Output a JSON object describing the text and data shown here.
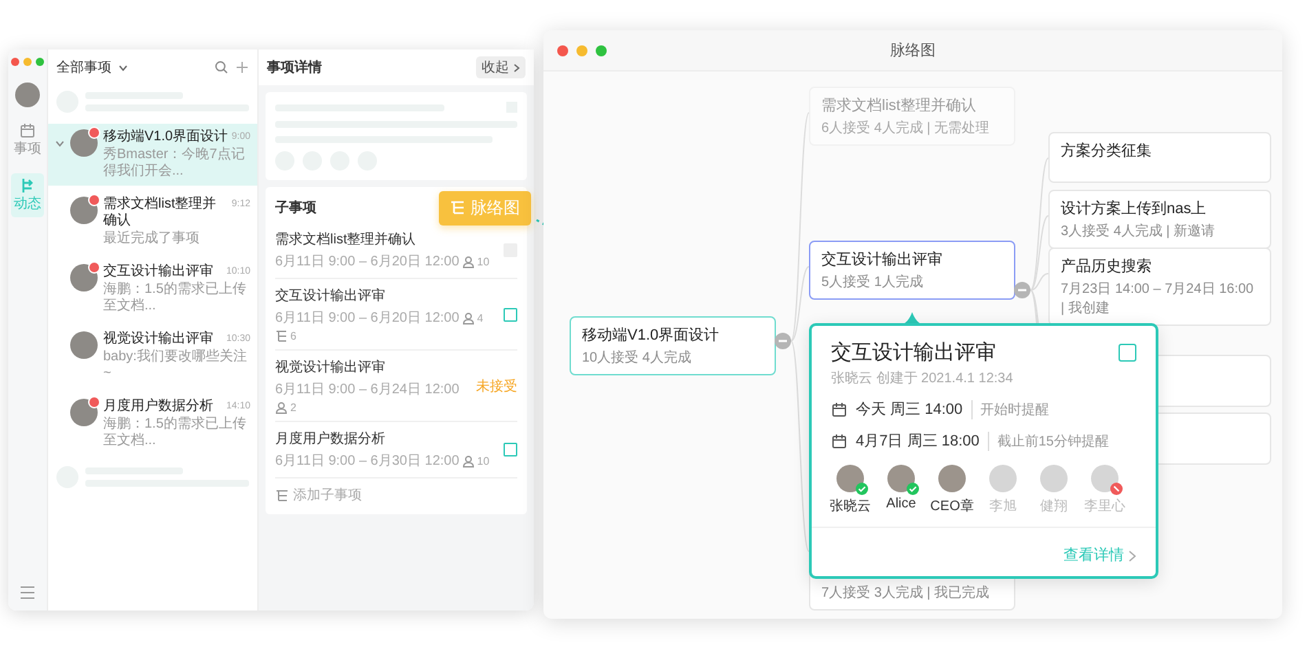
{
  "left_window": {
    "sidebar": [
      {
        "label": "事项",
        "selected": false
      },
      {
        "label": "动态",
        "selected": true
      }
    ],
    "list": {
      "filter": "全部事项",
      "items": [
        {
          "title": "移动端V1.0界面设计",
          "time": "9:00",
          "preview": "秀Bmaster：今晚7点记得我们开会...",
          "selected": true,
          "unread": true,
          "expanded": true,
          "children": [
            {
              "title": "需求文档list整理并确认",
              "time": "9:12",
              "preview": "最近完成了事项",
              "selected": false,
              "unread": true
            },
            {
              "title": "交互设计输出评审",
              "time": "10:10",
              "preview": "海鹏：1.5的需求已上传至文档...",
              "selected": false,
              "unread": true
            },
            {
              "title": "视觉设计输出评审",
              "time": "10:30",
              "preview": "baby:我们要改哪些关注~",
              "selected": false,
              "unread": false
            },
            {
              "title": "月度用户数据分析",
              "time": "14:10",
              "preview": "海鹏：1.5的需求已上传至文档...",
              "selected": false,
              "unread": true
            }
          ]
        }
      ]
    },
    "detail": {
      "title": "事项详情",
      "collapse_button": "收起",
      "section_title": "子事项",
      "subtasks": [
        {
          "title": "需求文档list整理并确认",
          "dates": "6月11日 9:00 – 6月20日 12:00",
          "assignees": "10",
          "kind": "checkbox",
          "disabled": true
        },
        {
          "title": "交互设计输出评审",
          "dates": "6月11日 9:00 – 6月20日 12:00",
          "assignees": "4",
          "subtasks": "6",
          "kind": "checkbox",
          "disabled": false
        },
        {
          "title": "视觉设计输出评审",
          "dates": "6月11日 9:00 – 6月24日 12:00",
          "assignees": "2",
          "kind": "status",
          "status": "未接受"
        },
        {
          "title": "月度用户数据分析",
          "dates": "6月11日 9:00 – 6月30日 12:00",
          "assignees": "10",
          "kind": "checkbox",
          "disabled": false
        }
      ],
      "add_button": "添加子事项"
    }
  },
  "mind_map_button": "脉络图",
  "right_window": {
    "title": "脉络图",
    "root": {
      "title": "移动端V1.0界面设计",
      "meta": "10人接受 4人完成"
    },
    "branches": [
      {
        "title": "需求文档list整理并确认",
        "meta": "6人接受 4人完成 | 无需处理",
        "faded": true,
        "selected": false
      },
      {
        "title": "交互设计输出评审",
        "meta": "5人接受 1人完成",
        "faded": false,
        "selected": true
      },
      {
        "meta": "7人接受 3人完成 | 我已完成",
        "faded": false,
        "selected": false
      }
    ],
    "leaves": [
      {
        "title": "方案分类征集"
      },
      {
        "title": "设计方案上传到nas上",
        "meta": "3人接受 4人完成 | 新邀请"
      },
      {
        "title": "产品历史搜索",
        "meta": "7月23日 14:00 – 7月24日 16:00 | 我创建"
      }
    ],
    "popup": {
      "title": "交互设计输出评审",
      "creator": "张晓云 创建于 2021.4.1 12:34",
      "checked": false,
      "schedule": [
        {
          "time": "今天 周三 14:00",
          "reminder": "开始时提醒"
        },
        {
          "time": "4月7日 周三 18:00",
          "reminder": "截止前15分钟提醒"
        }
      ],
      "participants": [
        {
          "name": "张晓云",
          "accepted": true,
          "completed": true,
          "declined": false
        },
        {
          "name": "Alice",
          "accepted": true,
          "completed": true,
          "declined": false
        },
        {
          "name": "CEO章",
          "accepted": true,
          "completed": false,
          "declined": false
        },
        {
          "name": "李旭",
          "accepted": false,
          "completed": false,
          "declined": false
        },
        {
          "name": "健翔",
          "accepted": false,
          "completed": false,
          "declined": false
        },
        {
          "name": "李里心",
          "accepted": false,
          "completed": false,
          "declined": true
        }
      ],
      "link": "查看详情"
    }
  }
}
